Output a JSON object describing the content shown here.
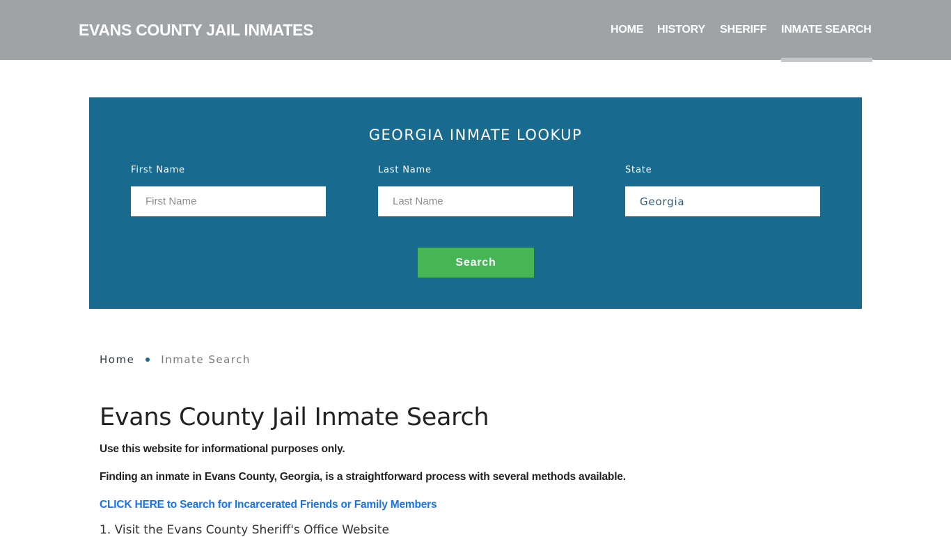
{
  "header": {
    "logo": "EVANS COUNTY JAIL INMATES",
    "nav": [
      {
        "label": "HOME",
        "active": false
      },
      {
        "label": "HISTORY",
        "active": false
      },
      {
        "label": "SHERIFF",
        "active": false
      },
      {
        "label": "INMATE SEARCH",
        "active": true
      }
    ]
  },
  "search_panel": {
    "title": "GEORGIA INMATE LOOKUP",
    "first_name": {
      "label": "First Name",
      "placeholder": "First Name",
      "value": ""
    },
    "last_name": {
      "label": "Last Name",
      "placeholder": "Last Name",
      "value": ""
    },
    "state": {
      "label": "State",
      "value": "Georgia"
    },
    "search_button": "Search"
  },
  "breadcrumb": {
    "home": "Home",
    "current": "Inmate Search"
  },
  "content": {
    "title": "Evans County Jail Inmate Search",
    "disclaimer": "Use this website for informational purposes only.",
    "intro": "Finding an inmate in Evans County, Georgia, is a straightforward process with several methods available.",
    "cta_link": "CLICK HERE to Search for Incarcerated Friends or Family Members",
    "list_item_1": "1. Visit the Evans County Sheriff's Office Website"
  },
  "colors": {
    "header_bg": "#9fa3a6",
    "panel_bg": "#186a8e",
    "button_green": "#45b556",
    "link_blue": "#1a73e8"
  }
}
